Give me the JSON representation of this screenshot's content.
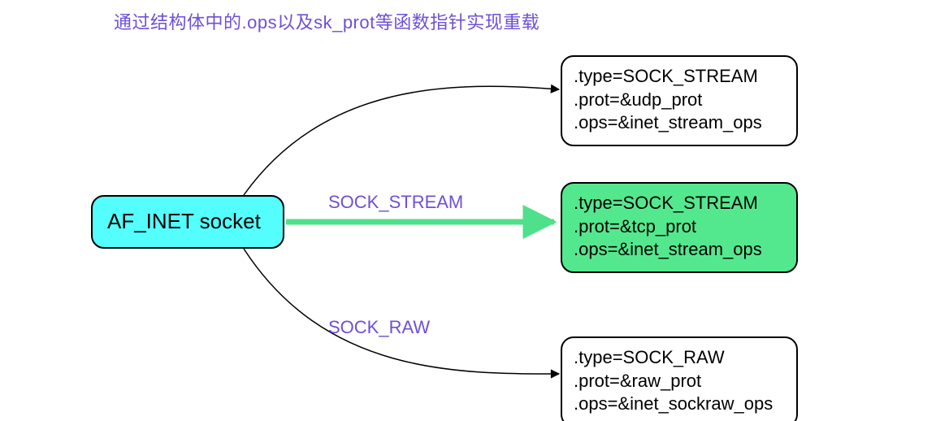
{
  "caption": "通过结构体中的.ops以及sk_prot等函数指针实现重载",
  "source": {
    "label": "AF_INET socket"
  },
  "edges": {
    "mid_label": "SOCK_STREAM",
    "bot_label": "SOCK_RAW"
  },
  "targets": {
    "top": {
      "line1": ".type=SOCK_STREAM",
      "line2": ".prot=&udp_prot",
      "line3": ".ops=&inet_stream_ops"
    },
    "mid": {
      "line1": ".type=SOCK_STREAM",
      "line2": ".prot=&tcp_prot",
      "line3": ".ops=&inet_stream_ops"
    },
    "bot": {
      "line1": ".type=SOCK_RAW",
      "line2": ".prot=&raw_prot",
      "line3": ".ops=&inet_sockraw_ops"
    }
  },
  "colors": {
    "caption": "#6d51d6",
    "source_bg": "#54fefc",
    "highlight_bg": "#54e88e",
    "highlight_arrow": "#4fe08b"
  }
}
